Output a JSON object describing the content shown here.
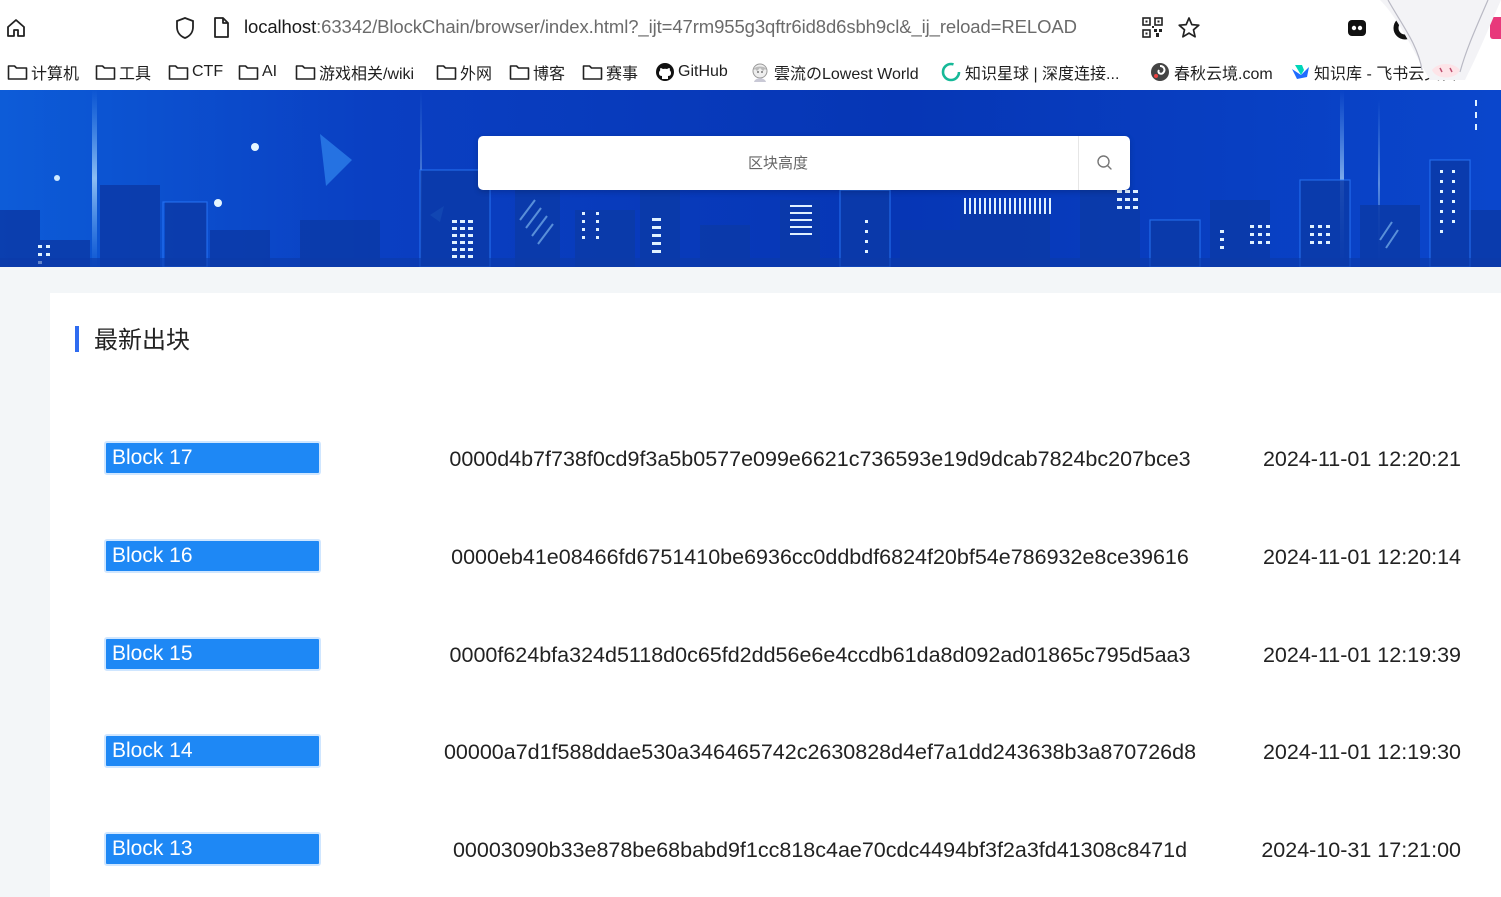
{
  "browser": {
    "url_host": "localhost",
    "url_rest": ":63342/BlockChain/browser/index.html?_ijt=47rm955g3qftr6id8d6sbh9cl&_ij_reload=RELOAD",
    "bookmarks": [
      {
        "label": "计算机",
        "icon": "folder-icon"
      },
      {
        "label": "工具",
        "icon": "folder-icon"
      },
      {
        "label": "CTF",
        "icon": "folder-icon"
      },
      {
        "label": "AI",
        "icon": "folder-icon"
      },
      {
        "label": "游戏相关/wiki",
        "icon": "folder-icon"
      },
      {
        "label": "外网",
        "icon": "folder-icon"
      },
      {
        "label": "博客",
        "icon": "folder-icon"
      },
      {
        "label": "赛事",
        "icon": "folder-icon"
      },
      {
        "label": "GitHub",
        "icon": "github-icon"
      },
      {
        "label": "雲流のLowest World",
        "icon": "anime-avatar-icon"
      },
      {
        "label": "知识星球 | 深度连接...",
        "icon": "green-ring-icon"
      },
      {
        "label": "春秋云境.com",
        "icon": "spiral-icon"
      },
      {
        "label": "知识库 - 飞书云文档",
        "icon": "feishu-icon"
      }
    ]
  },
  "search": {
    "placeholder": "区块高度"
  },
  "section": {
    "title": "最新出块"
  },
  "blocks": [
    {
      "label": "Block 17",
      "hash": "0000d4b7f738f0cd9f3a5b0577e099e6621c736593e19d9dcab7824bc207bce3",
      "time": "2024-11-01 12:20:21"
    },
    {
      "label": "Block 16",
      "hash": "0000eb41e08466fd6751410be6936cc0ddbdf6824f20bf54e786932e8ce39616",
      "time": "2024-11-01 12:20:14"
    },
    {
      "label": "Block 15",
      "hash": "0000f624bfa324d5118d0c65fd2dd56e6e4ccdb61da8d092ad01865c795d5aa3",
      "time": "2024-11-01 12:19:39"
    },
    {
      "label": "Block 14",
      "hash": "00000a7d1f588ddae530a346465742c2630828d4ef7a1dd243638b3a870726d8",
      "time": "2024-11-01 12:19:30"
    },
    {
      "label": "Block 13",
      "hash": "00003090b33e878be68babd9f1cc818c4ae70cdc4494bf3f2a3fd41308c8471d",
      "time": "2024-10-31 17:21:00"
    }
  ],
  "colors": {
    "accent": "#2f6cf0",
    "block_button": "#1e88f5",
    "hero": "#0a3ec4",
    "page_bg": "#f3f6f8"
  }
}
